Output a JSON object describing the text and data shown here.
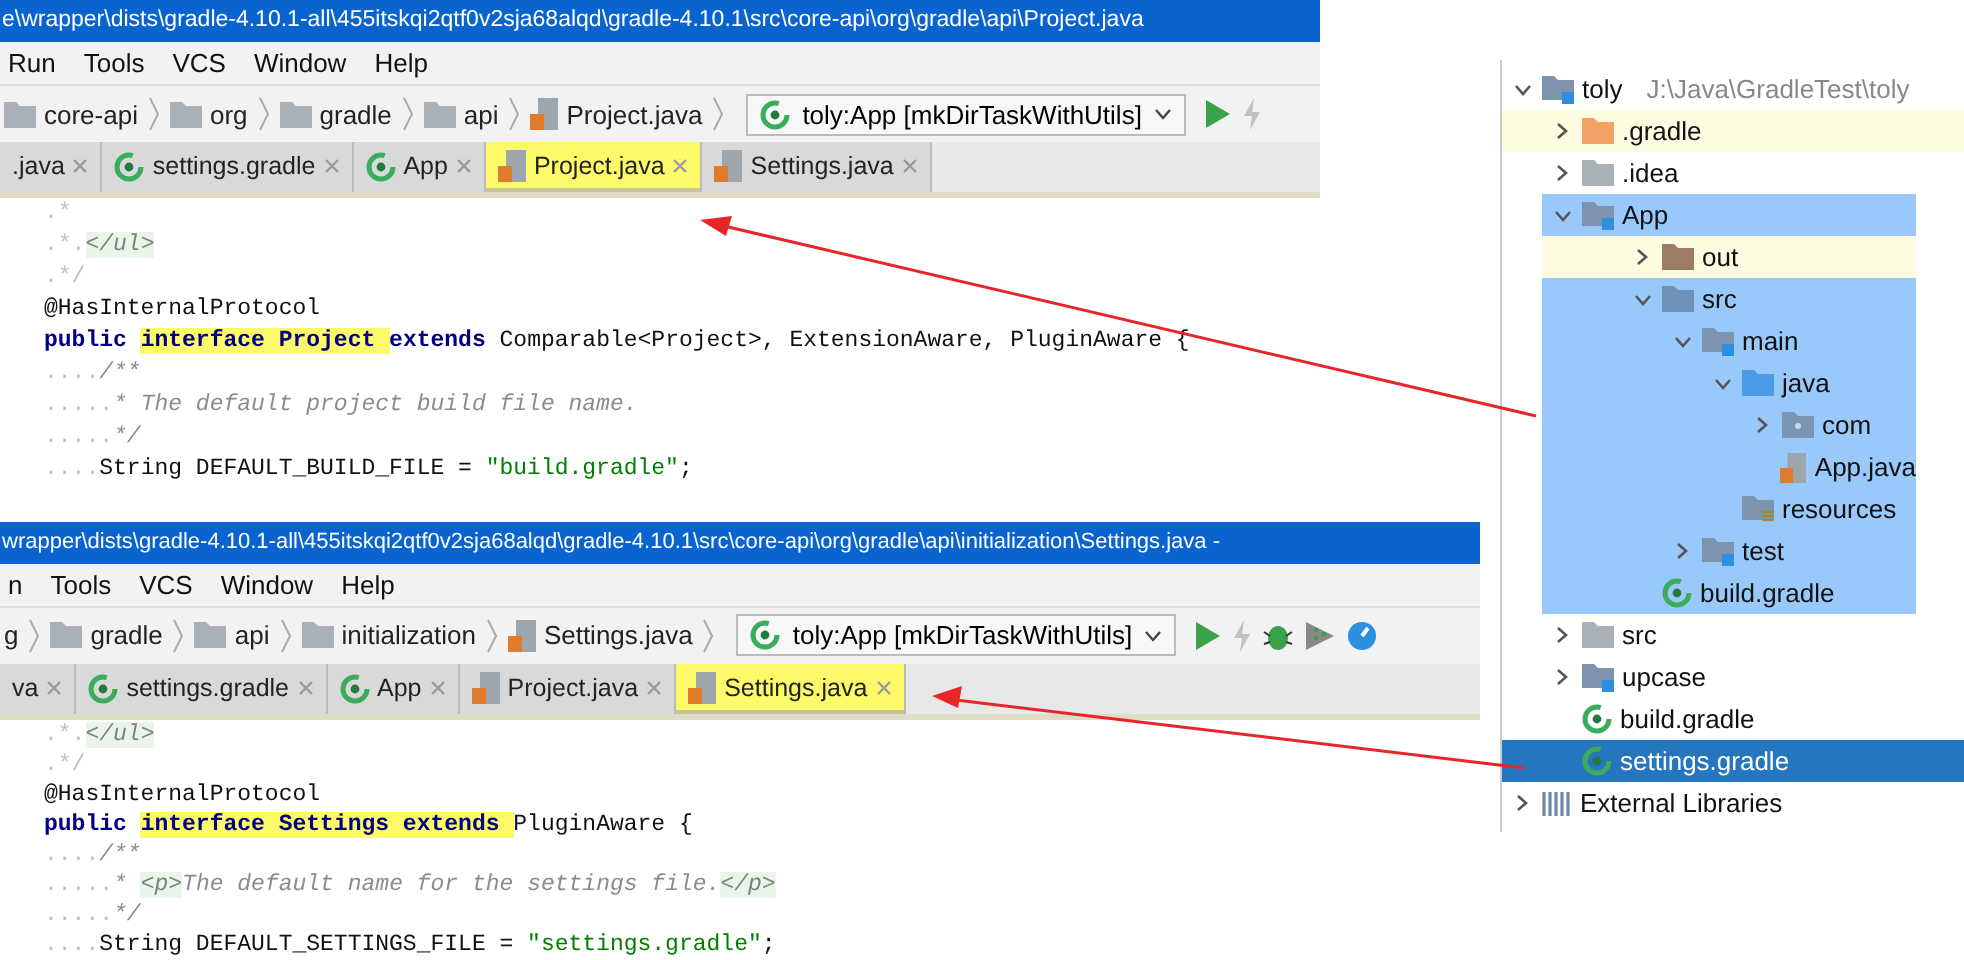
{
  "windows": [
    {
      "title": "e\\wrapper\\dists\\gradle-4.10.1-all\\455itskqi2qtf0v2sja68alqd\\gradle-4.10.1\\src\\core-api\\org\\gradle\\api\\Project.java",
      "menu": [
        "Run",
        "Tools",
        "VCS",
        "Window",
        "Help"
      ],
      "breadcrumb": [
        {
          "label": "core-api",
          "kind": "folder"
        },
        {
          "label": "org",
          "kind": "folder"
        },
        {
          "label": "gradle",
          "kind": "folder"
        },
        {
          "label": "api",
          "kind": "folder"
        },
        {
          "label": "Project.java",
          "kind": "java"
        }
      ],
      "run_config": "toly:App [mkDirTaskWithUtils]",
      "tabs": [
        {
          "label": ".java",
          "kind": "none",
          "selected": false,
          "highlighted": false
        },
        {
          "label": "settings.gradle",
          "kind": "gradle",
          "selected": false,
          "highlighted": false
        },
        {
          "label": "App",
          "kind": "gradle",
          "selected": false,
          "highlighted": false
        },
        {
          "label": "Project.java",
          "kind": "java",
          "selected": true,
          "highlighted": true
        },
        {
          "label": "Settings.java",
          "kind": "java",
          "selected": false,
          "highlighted": false
        }
      ],
      "code": [
        [
          {
            "text": ".*",
            "kind": "ws"
          }
        ],
        [
          {
            "text": ".*.",
            "kind": "ws"
          },
          {
            "text": "</ul>",
            "kind": "tag"
          }
        ],
        [
          {
            "text": ".*/",
            "kind": "ws"
          }
        ],
        [
          {
            "text": "@HasInternalProtocol",
            "kind": "plain"
          }
        ],
        [
          {
            "text": "public ",
            "kind": "keyword"
          },
          {
            "text": "interface Project ",
            "kind": "keyword-hl",
            "highlighted": true
          },
          {
            "text": "extends ",
            "kind": "keyword"
          },
          {
            "text": "Comparable<Project>, ExtensionAware, PluginAware {",
            "kind": "plain"
          }
        ],
        [
          {
            "text": "....",
            "kind": "ws"
          },
          {
            "text": "/**",
            "kind": "comment"
          }
        ],
        [
          {
            "text": ".....",
            "kind": "ws"
          },
          {
            "text": "* The default project build file name.",
            "kind": "comment"
          }
        ],
        [
          {
            "text": ".....",
            "kind": "ws"
          },
          {
            "text": "*/",
            "kind": "comment"
          }
        ],
        [
          {
            "text": "....",
            "kind": "ws"
          },
          {
            "text": "String DEFAULT_BUILD_FILE = ",
            "kind": "plain"
          },
          {
            "text": "\"build.gradle\"",
            "kind": "string"
          },
          {
            "text": ";",
            "kind": "plain"
          }
        ]
      ]
    },
    {
      "title": "wrapper\\dists\\gradle-4.10.1-all\\455itskqi2qtf0v2sja68alqd\\gradle-4.10.1\\src\\core-api\\org\\gradle\\api\\initialization\\Settings.java -",
      "menu": [
        "n",
        "Tools",
        "VCS",
        "Window",
        "Help"
      ],
      "breadcrumb": [
        {
          "label": "g",
          "kind": "none"
        },
        {
          "label": "gradle",
          "kind": "folder"
        },
        {
          "label": "api",
          "kind": "folder"
        },
        {
          "label": "initialization",
          "kind": "folder"
        },
        {
          "label": "Settings.java",
          "kind": "java"
        }
      ],
      "run_config": "toly:App [mkDirTaskWithUtils]",
      "tabs": [
        {
          "label": "va",
          "kind": "none",
          "selected": false,
          "highlighted": false
        },
        {
          "label": "settings.gradle",
          "kind": "gradle",
          "selected": false,
          "highlighted": false
        },
        {
          "label": "App",
          "kind": "gradle",
          "selected": false,
          "highlighted": false
        },
        {
          "label": "Project.java",
          "kind": "java",
          "selected": false,
          "highlighted": false
        },
        {
          "label": "Settings.java",
          "kind": "java",
          "selected": true,
          "highlighted": true
        }
      ],
      "code": [
        [
          {
            "text": ".*.",
            "kind": "ws"
          },
          {
            "text": "</ul>",
            "kind": "tag"
          }
        ],
        [
          {
            "text": ".*/",
            "kind": "ws"
          }
        ],
        [
          {
            "text": "@HasInternalProtocol",
            "kind": "plain"
          }
        ],
        [
          {
            "text": "public ",
            "kind": "keyword"
          },
          {
            "text": "interface Settings extends ",
            "kind": "keyword-hl",
            "highlighted": true
          },
          {
            "text": "PluginAware {",
            "kind": "plain"
          }
        ],
        [
          {
            "text": "....",
            "kind": "ws"
          },
          {
            "text": "/**",
            "kind": "comment"
          }
        ],
        [
          {
            "text": ".....",
            "kind": "ws"
          },
          {
            "text": "* ",
            "kind": "comment"
          },
          {
            "text": "<p>",
            "kind": "tag"
          },
          {
            "text": "The default name for the settings file.",
            "kind": "comment"
          },
          {
            "text": "</p>",
            "kind": "tag"
          }
        ],
        [
          {
            "text": ".....",
            "kind": "ws"
          },
          {
            "text": "*/",
            "kind": "comment"
          }
        ],
        [
          {
            "text": "....",
            "kind": "ws"
          },
          {
            "text": "String DEFAULT_SETTINGS_FILE = ",
            "kind": "plain"
          },
          {
            "text": "\"settings.gradle\"",
            "kind": "string"
          },
          {
            "text": ";",
            "kind": "plain"
          }
        ]
      ]
    }
  ],
  "tree": [
    {
      "label": "toly",
      "hint": "J:\\Java\\GradleTest\\toly",
      "kind": "module",
      "expanded": true,
      "children": [
        {
          "label": ".gradle",
          "kind": "folder-orange",
          "expanded": false,
          "ignored": true
        },
        {
          "label": ".idea",
          "kind": "folder",
          "expanded": false
        },
        {
          "label": "App",
          "kind": "module",
          "expanded": true,
          "highlighted": true,
          "children": [
            {
              "label": "out",
              "kind": "folder-brown",
              "expanded": false,
              "ignored": true
            },
            {
              "label": "src",
              "kind": "folder-blue",
              "expanded": true,
              "children": [
                {
                  "label": "main",
                  "kind": "module",
                  "expanded": true,
                  "children": [
                    {
                      "label": "java",
                      "kind": "folder-source",
                      "expanded": true,
                      "children": [
                        {
                          "label": "com",
                          "kind": "package",
                          "expanded": false
                        },
                        {
                          "label": "App.java",
                          "kind": "java"
                        }
                      ]
                    },
                    {
                      "label": "resources",
                      "kind": "resources"
                    }
                  ]
                },
                {
                  "label": "test",
                  "kind": "module",
                  "expanded": false
                }
              ]
            },
            {
              "label": "build.gradle",
              "kind": "gradle"
            }
          ]
        },
        {
          "label": "src",
          "kind": "folder",
          "expanded": false
        },
        {
          "label": "upcase",
          "kind": "module",
          "expanded": false
        },
        {
          "label": "build.gradle",
          "kind": "gradle"
        },
        {
          "label": "settings.gradle",
          "kind": "gradle",
          "selected": true
        }
      ]
    },
    {
      "label": "External Libraries",
      "kind": "libraries",
      "expanded": false
    }
  ]
}
